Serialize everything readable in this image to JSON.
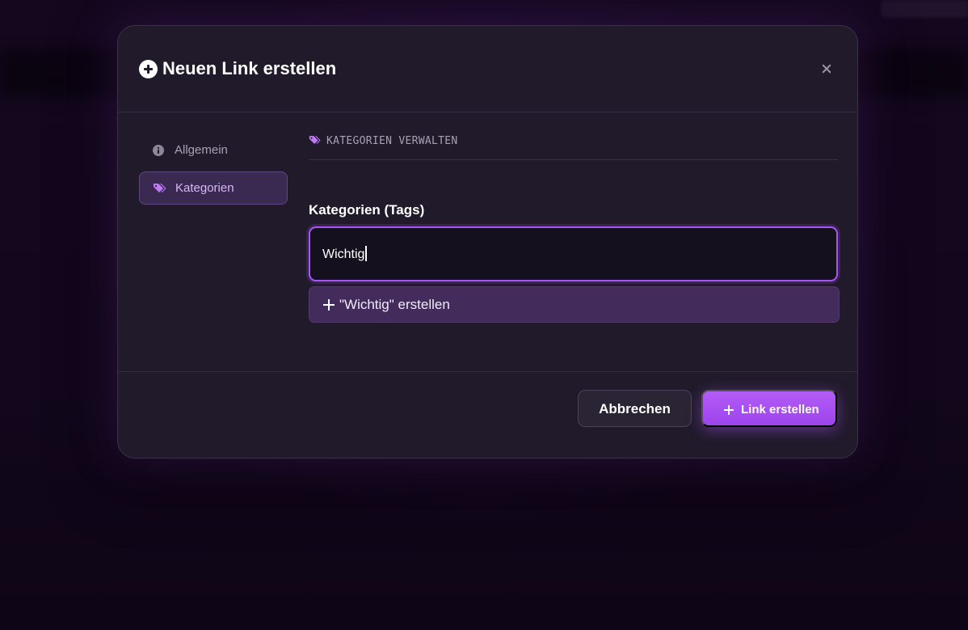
{
  "modal": {
    "title": "Neuen Link erstellen",
    "title_icon": "plus-circle-icon",
    "close_icon": "close-icon"
  },
  "sidebar": {
    "items": [
      {
        "label": "Allgemein",
        "icon": "info-circle-icon",
        "active": false
      },
      {
        "label": "Kategorien",
        "icon": "tags-icon",
        "active": true
      }
    ]
  },
  "section": {
    "title": "KATEGORIEN VERWALTEN",
    "icon": "tags-icon"
  },
  "tags_field": {
    "label": "Kategorien (Tags)",
    "value": "Wichtig"
  },
  "suggestion": {
    "text": "\"Wichtig\" erstellen",
    "icon": "plus-icon"
  },
  "footer": {
    "cancel_label": "Abbrechen",
    "create_label": "Link erstellen"
  },
  "colors": {
    "accent": "#a855f7",
    "modal_background": "#201a2a",
    "page_background": "#10061a"
  }
}
